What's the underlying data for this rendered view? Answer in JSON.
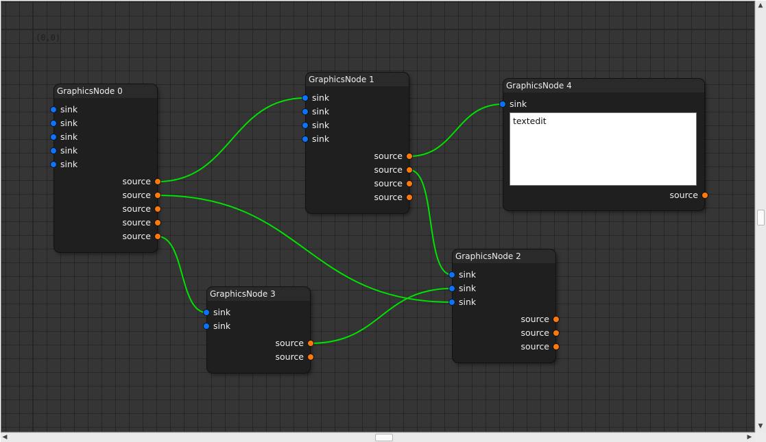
{
  "canvas": {
    "origin_label": "(0,0)"
  },
  "colors": {
    "background": "#353535",
    "node_body": "#1f1f1f",
    "node_title": "#2a2a2a",
    "sink_port": "#0a74ff",
    "source_port": "#ff7a0a",
    "edge": "#00e300"
  },
  "nodes": [
    {
      "title": "GraphicsNode 0",
      "sinks": [
        "sink",
        "sink",
        "sink",
        "sink",
        "sink"
      ],
      "sources": [
        "source",
        "source",
        "source",
        "source",
        "source"
      ]
    },
    {
      "title": "GraphicsNode 1",
      "sinks": [
        "sink",
        "sink",
        "sink",
        "sink"
      ],
      "sources": [
        "source",
        "source",
        "source",
        "source"
      ]
    },
    {
      "title": "GraphicsNode 2",
      "sinks": [
        "sink",
        "sink",
        "sink"
      ],
      "sources": [
        "source",
        "source",
        "source"
      ]
    },
    {
      "title": "GraphicsNode 3",
      "sinks": [
        "sink",
        "sink"
      ],
      "sources": [
        "source",
        "source"
      ]
    },
    {
      "title": "GraphicsNode 4",
      "sinks": [
        "sink"
      ],
      "sources": [
        "source"
      ],
      "textedit_value": "textedit"
    }
  ],
  "edges": [
    {
      "from_node": 0,
      "from_port": 0,
      "to_node": 1,
      "to_port": 0
    },
    {
      "from_node": 0,
      "from_port": 1,
      "to_node": 2,
      "to_port": 2
    },
    {
      "from_node": 0,
      "from_port": 4,
      "to_node": 3,
      "to_port": 0
    },
    {
      "from_node": 1,
      "from_port": 0,
      "to_node": 4,
      "to_port": 0
    },
    {
      "from_node": 1,
      "from_port": 1,
      "to_node": 2,
      "to_port": 0
    },
    {
      "from_node": 3,
      "from_port": 0,
      "to_node": 2,
      "to_port": 1
    }
  ],
  "scrollbars": {
    "up_arrow": "▲",
    "down_arrow": "▼",
    "left_arrow": "◀",
    "right_arrow": "▶"
  }
}
